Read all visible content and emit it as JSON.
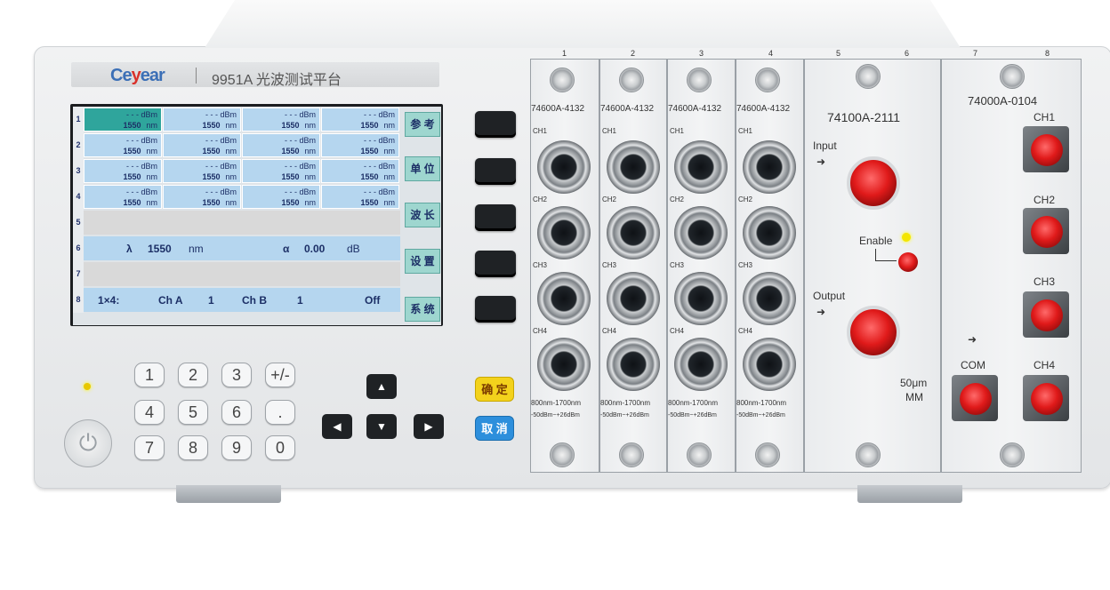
{
  "brand": {
    "logo_main": "Ce",
    "logo_accent": "y",
    "logo_tail": "ear",
    "model": "9951A 光波测试平台"
  },
  "screen": {
    "rows": [
      {
        "num": "1",
        "cells": [
          {
            "top": "- - - dBm",
            "wl": "1550",
            "unit": "nm",
            "selected": true
          },
          {
            "top": "- - - dBm",
            "wl": "1550",
            "unit": "nm"
          },
          {
            "top": "- - - dBm",
            "wl": "1550",
            "unit": "nm"
          },
          {
            "top": "- - - dBm",
            "wl": "1550",
            "unit": "nm"
          }
        ]
      },
      {
        "num": "2",
        "cells": [
          {
            "top": "- - - dBm",
            "wl": "1550",
            "unit": "nm"
          },
          {
            "top": "- - - dBm",
            "wl": "1550",
            "unit": "nm"
          },
          {
            "top": "- - - dBm",
            "wl": "1550",
            "unit": "nm"
          },
          {
            "top": "- - - dBm",
            "wl": "1550",
            "unit": "nm"
          }
        ]
      },
      {
        "num": "3",
        "cells": [
          {
            "top": "- - - dBm",
            "wl": "1550",
            "unit": "nm"
          },
          {
            "top": "- - - dBm",
            "wl": "1550",
            "unit": "nm"
          },
          {
            "top": "- - - dBm",
            "wl": "1550",
            "unit": "nm"
          },
          {
            "top": "- - - dBm",
            "wl": "1550",
            "unit": "nm"
          }
        ]
      },
      {
        "num": "4",
        "cells": [
          {
            "top": "- - - dBm",
            "wl": "1550",
            "unit": "nm"
          },
          {
            "top": "- - - dBm",
            "wl": "1550",
            "unit": "nm"
          },
          {
            "top": "- - - dBm",
            "wl": "1550",
            "unit": "nm"
          },
          {
            "top": "- - - dBm",
            "wl": "1550",
            "unit": "nm"
          }
        ]
      }
    ],
    "row5": {
      "num": "5"
    },
    "row6": {
      "num": "6",
      "lambda": "λ",
      "wl": "1550",
      "wl_unit": "nm",
      "alpha": "α",
      "att": "0.00",
      "att_unit": "dB"
    },
    "row7": {
      "num": "7"
    },
    "row8": {
      "num": "8",
      "mode": "1×4:",
      "cha": "Ch A",
      "cha_val": "1",
      "chb": "Ch B",
      "chb_val": "1",
      "state": "Off"
    },
    "softkeys": [
      "参 考",
      "单 位",
      "波 长",
      "设 置",
      "系 统"
    ]
  },
  "keypad": [
    "1",
    "2",
    "3",
    "+/-",
    "4",
    "5",
    "6",
    ".",
    "7",
    "8",
    "9",
    "0"
  ],
  "arrows": {
    "up": "▲",
    "left": "◀",
    "down": "▼",
    "right": "▶"
  },
  "confirm": {
    "ok": "确 定",
    "cancel": "取 消"
  },
  "power_icon": "⏻",
  "slot_numbers": [
    "1",
    "2",
    "3",
    "4",
    "5",
    "6",
    "7",
    "8"
  ],
  "detector_modules": [
    {
      "model": "74600A-4132",
      "ch1": "CH1",
      "ch2": "CH2",
      "ch3": "CH3",
      "ch4": "CH4",
      "range": "800nm-1700nm",
      "power": "-50dBm~+26dBm"
    },
    {
      "model": "74600A-4132",
      "ch1": "CH1",
      "ch2": "CH2",
      "ch3": "CH3",
      "ch4": "CH4",
      "range": "800nm-1700nm",
      "power": "-50dBm~+26dBm"
    },
    {
      "model": "74600A-4132",
      "ch1": "CH1",
      "ch2": "CH2",
      "ch3": "CH3",
      "ch4": "CH4",
      "range": "800nm-1700nm",
      "power": "-50dBm~+26dBm"
    },
    {
      "model": "74600A-4132",
      "ch1": "CH1",
      "ch2": "CH2",
      "ch3": "CH3",
      "ch4": "CH4",
      "range": "800nm-1700nm",
      "power": "-50dBm~+26dBm"
    }
  ],
  "attenuator": {
    "model": "74100A-2111",
    "input": "Input",
    "enable": "Enable",
    "output": "Output",
    "fiber": "50μm",
    "mode": "MM"
  },
  "switch": {
    "model": "74000A-0104",
    "ch1": "CH1",
    "ch2": "CH2",
    "ch3": "CH3",
    "ch4": "CH4",
    "com": "COM"
  },
  "colors": {
    "cell": "#b5d6ef",
    "cell_selected": "#2fa59c",
    "softkey": "#9ed6cf",
    "ok": "#f3d21c",
    "cancel": "#2d8fdc",
    "brand_blue": "#3b6fb6",
    "brand_red": "#d9312b"
  }
}
